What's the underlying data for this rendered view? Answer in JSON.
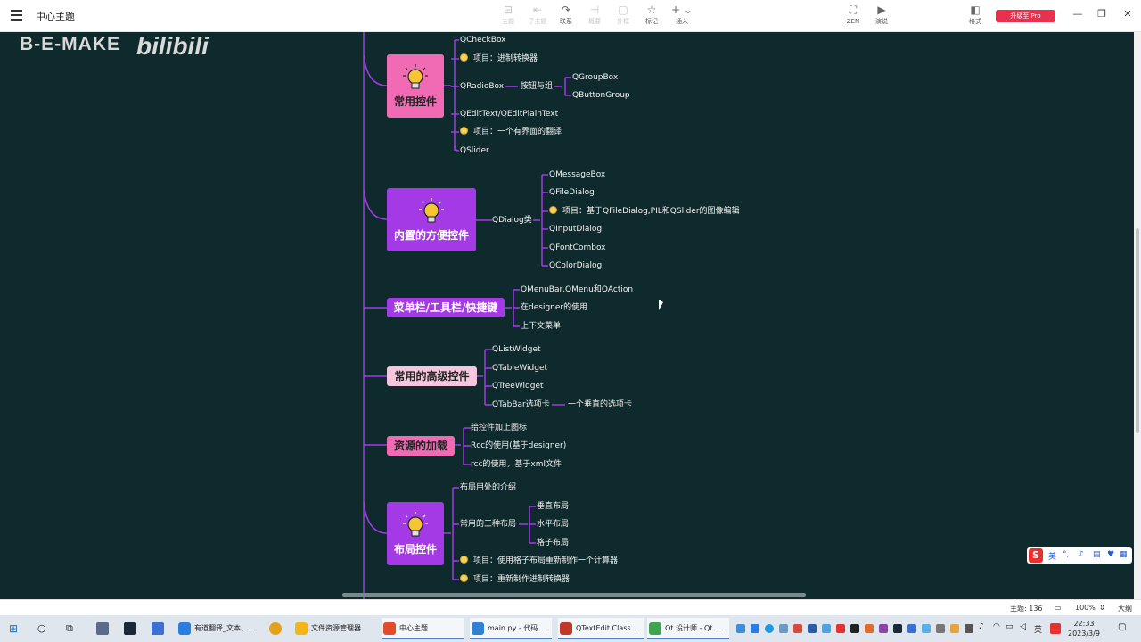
{
  "app": {
    "title": "中心主题"
  },
  "toolbar": {
    "buttons": [
      {
        "icon": "subtopic-icon",
        "glyph": "⊟",
        "label": "主题",
        "enabled": false
      },
      {
        "icon": "child-topic-icon",
        "glyph": "⇤",
        "label": "子主题",
        "enabled": false
      },
      {
        "icon": "relation-icon",
        "glyph": "↷",
        "label": "联系",
        "enabled": true
      },
      {
        "icon": "summary-icon",
        "glyph": "⊣",
        "label": "概要",
        "enabled": false
      },
      {
        "icon": "boundary-icon",
        "glyph": "▢",
        "label": "外框",
        "enabled": false
      },
      {
        "icon": "marker-icon",
        "glyph": "☆",
        "label": "标记",
        "enabled": true
      },
      {
        "icon": "insert-icon",
        "glyph": "+ ⌄",
        "label": "插入",
        "enabled": true
      },
      {
        "icon": "zen-icon",
        "glyph": "⛶",
        "label": "ZEN",
        "enabled": true
      },
      {
        "icon": "present-icon",
        "glyph": "▶",
        "label": "演说",
        "enabled": true
      },
      {
        "icon": "format-icon",
        "glyph": "◧",
        "label": "格式",
        "enabled": true
      }
    ],
    "upgrade": "升级至 Pro"
  },
  "watermark": {
    "text": "B-E-MAKE",
    "logo": "bilibili"
  },
  "mindmap": {
    "nodes": {
      "common_controls": "常用控件",
      "builtin_controls": "内置的方便控件",
      "menubar": "菜单栏/工具栏/快捷键",
      "advanced_controls": "常用的高级控件",
      "resources": "资源的加载",
      "layout_controls": "布局控件"
    },
    "leaves": {
      "qcheckbox": "QCheckBox",
      "proj_base": "项目：进制转换器",
      "qradiobox": "QRadioBox",
      "btn_group": "按钮与组",
      "qgroupbox": "QGroupBox",
      "qbuttongroup": "QButtonGroup",
      "qedittext": "QEditText/QEditPlainText",
      "proj_translate": "项目：一个有界面的翻译",
      "qslider": "QSlider",
      "qdialog": "QDialog类",
      "qmessagebox": "QMessageBox",
      "qfiledialog": "QFileDialog",
      "proj_image": "项目：基于QFileDialog,PIL和QSlider的图像编辑",
      "qinputdialog": "QInputDialog",
      "qfontcombox": "QFontCombox",
      "qcolordialog": "QColorDialog",
      "qmenubar": "QMenuBar,QMenu和QAction",
      "designer_use": "在designer的使用",
      "context_menu": "上下文菜单",
      "qlistwidget": "QListWidget",
      "qtablewidget": "QTableWidget",
      "qtreewidget": "QTreeWidget",
      "qtabbar": "QTabBar选项卡",
      "vertical_tab": "一个垂直的选项卡",
      "add_icon": "给控件加上图标",
      "rcc_designer": "Rcc的使用(基于designer)",
      "rcc_xml": "rcc的使用，基于xml文件",
      "layout_intro": "布局用处的介绍",
      "three_layouts": "常用的三种布局",
      "vbox": "垂直布局",
      "hbox": "水平布局",
      "grid": "格子布局",
      "proj_calc": "项目：使用格子布局重新制作一个计算器",
      "proj_remake": "项目：重新制作进制转换器"
    }
  },
  "ime": {
    "lang": "英"
  },
  "statusbar": {
    "topics": "主题: 136",
    "zoom": "100%",
    "size": "大纲"
  },
  "taskbar": {
    "items": [
      {
        "label": "有道翻译_文本、...",
        "color": "#2a7de1"
      },
      {
        "label": "文件资源管理器",
        "color": "#f2b619"
      },
      {
        "label": "中心主题",
        "color": "#e44b2c"
      },
      {
        "label": "main.py - 代码 ...",
        "color": "#2f7fd3"
      },
      {
        "label": "QTextEdit Class...",
        "color": "#c0392b"
      },
      {
        "label": "Qt 设计师 - Qt ...",
        "color": "#3fa34d"
      }
    ],
    "tray_lang": "英",
    "time": "22:33",
    "date": "2023/3/9"
  },
  "colors": {
    "canvas": "#0f2a2d",
    "edge": "#a43ae6",
    "pink": "#f06bb4",
    "violet": "#a43ae6"
  }
}
